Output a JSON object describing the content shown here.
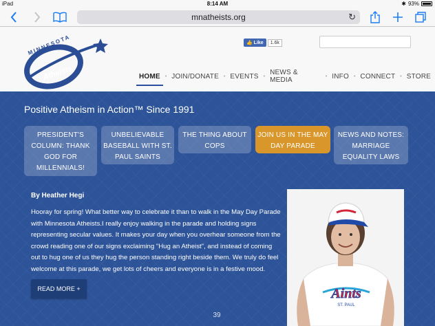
{
  "status_bar": {
    "device": "iPad",
    "time": "8:14 AM",
    "battery": "93%"
  },
  "browser": {
    "url": "mnatheists.org"
  },
  "header": {
    "logo": {
      "word_top": "MINNESOTA",
      "word_bottom": "Atheists"
    },
    "fb_like": {
      "label": "Like",
      "count": "1.6k"
    },
    "nav": [
      {
        "label": "HOME"
      },
      {
        "label": "JOIN/DONATE"
      },
      {
        "label": "EVENTS"
      },
      {
        "label": "NEWS & MEDIA"
      },
      {
        "label": "INFO"
      },
      {
        "label": "CONNECT"
      },
      {
        "label": "STORE"
      }
    ]
  },
  "main": {
    "tagline": "Positive Atheism in Action™ Since 1991",
    "tabs": [
      {
        "label": "PRESIDENT'S COLUMN: THANK GOD FOR MILLENNIALS!"
      },
      {
        "label": "UNBELIEVABLE BASEBALL WITH ST. PAUL SAINTS"
      },
      {
        "label": "THE THING ABOUT COPS"
      },
      {
        "label": "JOIN US IN THE MAY DAY PARADE"
      },
      {
        "label": "NEWS AND NOTES: MARRIAGE EQUALITY LAWS"
      }
    ],
    "byline": "By Heather Hegi",
    "article": "Hooray for spring! What better way to celebrate it than to walk in the May Day Parade with Minnesota Atheists.I really enjoy walking in the parade and holding signs representing secular values. It makes your day when you overhear someone from the crowd reading one of our signs exclaiming \"Hug an Atheist\", and instead of coming out to hug one of us they hug the person standing right beside them. We truly do feel welcome at this parade, we get lots of cheers and everyone is in a festive mood.",
    "read_more": "READ MORE +",
    "photo_shirt_text": "Aints",
    "photo_shirt_subtext": "ST. PAUL",
    "page_number": "39"
  },
  "colors": {
    "accent": "#1a7cf5",
    "brand_blue": "#2d5398",
    "active_tab": "#d9962b"
  }
}
